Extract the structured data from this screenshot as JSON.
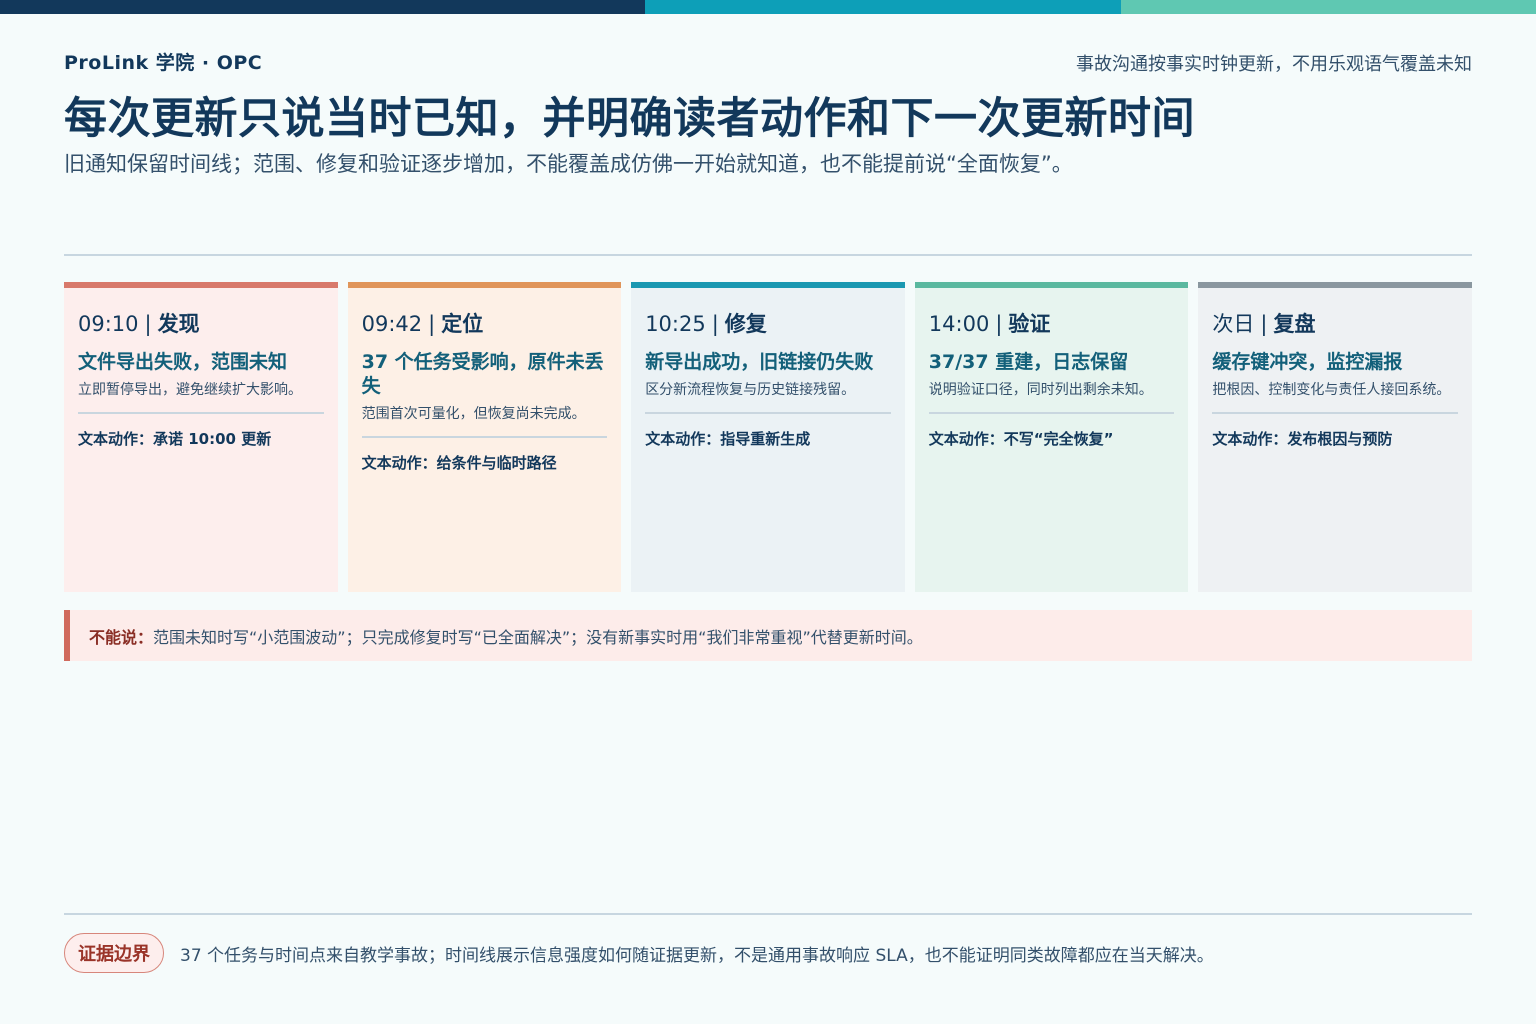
{
  "header": {
    "brand": "ProLink 学院 · OPC",
    "tagline": "事故沟通按事实时钟更新，不用乐观语气覆盖未知",
    "title": "每次更新只说当时已知，并明确读者动作和下一次更新时间",
    "subtitle": "旧通知保留时间线；范围、修复和验证逐步增加，不能覆盖成仿佛一开始就知道，也不能提前说“全面恢复”。"
  },
  "colors": {
    "topbar": [
      "#12385b",
      "#0d9fb8",
      "#5fc8b2"
    ],
    "card_accents": [
      "#d8796b",
      "#e0955a",
      "#1a98b1",
      "#5ab89f",
      "#8a979f"
    ]
  },
  "cards": [
    {
      "time": "09:10",
      "stage": "发现",
      "headline": "文件导出失败，范围未知",
      "desc": "立即暂停导出，避免继续扩大影响。",
      "action": "文本动作：承诺 10:00 更新"
    },
    {
      "time": "09:42",
      "stage": "定位",
      "headline": "37 个任务受影响，原件未丢失",
      "desc": "范围首次可量化，但恢复尚未完成。",
      "action": "文本动作：给条件与临时路径"
    },
    {
      "time": "10:25",
      "stage": "修复",
      "headline": "新导出成功，旧链接仍失败",
      "desc": "区分新流程恢复与历史链接残留。",
      "action": "文本动作：指导重新生成"
    },
    {
      "time": "14:00",
      "stage": "验证",
      "headline": "37/37 重建，日志保留",
      "desc": "说明验证口径，同时列出剩余未知。",
      "action": "文本动作：不写“完全恢复”"
    },
    {
      "time": "次日",
      "stage": "复盘",
      "headline": "缓存键冲突，监控漏报",
      "desc": "把根因、控制变化与责任人接回系统。",
      "action": "文本动作：发布根因与预防"
    }
  ],
  "separator": "|",
  "warning": {
    "label": "不能说：",
    "text": "范围未知时写“小范围波动”；只完成修复时写“已全面解决”；没有新事实时用“我们非常重视”代替更新时间。"
  },
  "footer": {
    "badge": "证据边界",
    "text": "37 个任务与时间点来自教学事故；时间线展示信息强度如何随证据更新，不是通用事故响应 SLA，也不能证明同类故障都应在当天解决。"
  }
}
